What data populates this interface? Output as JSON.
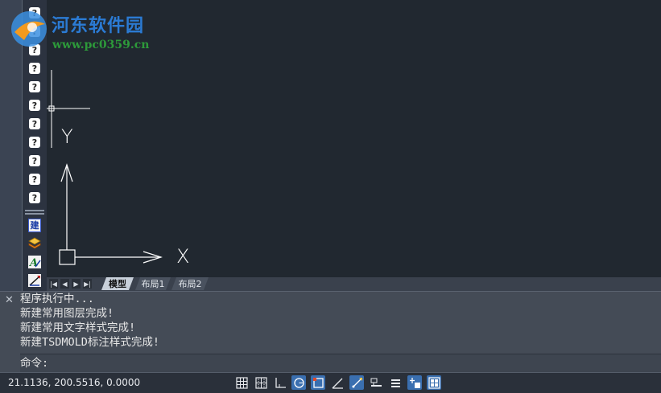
{
  "watermark": {
    "title": "河东软件园",
    "url": "www.pc0359.cn"
  },
  "toolbar": {
    "unknown_icon_glyph": "?",
    "build_icon_glyph": "建"
  },
  "ucs": {
    "x_label": "X",
    "y_label": "Y"
  },
  "layout_tabs": {
    "tabs": [
      "模型",
      "布局1",
      "布局2"
    ],
    "active": "模型"
  },
  "command": {
    "history": [
      "程序执行中...",
      "新建常用图层完成!",
      "新建常用文字样式完成!",
      "新建TSDMOLD标注样式完成!"
    ],
    "prompt": "命令:",
    "input_value": ""
  },
  "status": {
    "coordinates": "21.1136, 200.5516, 0.0000",
    "buttons": [
      "grid-icon",
      "snap-grid-icon",
      "ortho-icon",
      "polar-icon",
      "object-snap-icon",
      "angle-icon",
      "dynamic-input-icon",
      "lineweight-icon",
      "properties-icon",
      "annotation-icon",
      "workspace-icon"
    ]
  },
  "colors": {
    "canvas_bg": "#212830",
    "watermark_blue": "#2b7bd4",
    "watermark_green": "#2d9a3a"
  }
}
